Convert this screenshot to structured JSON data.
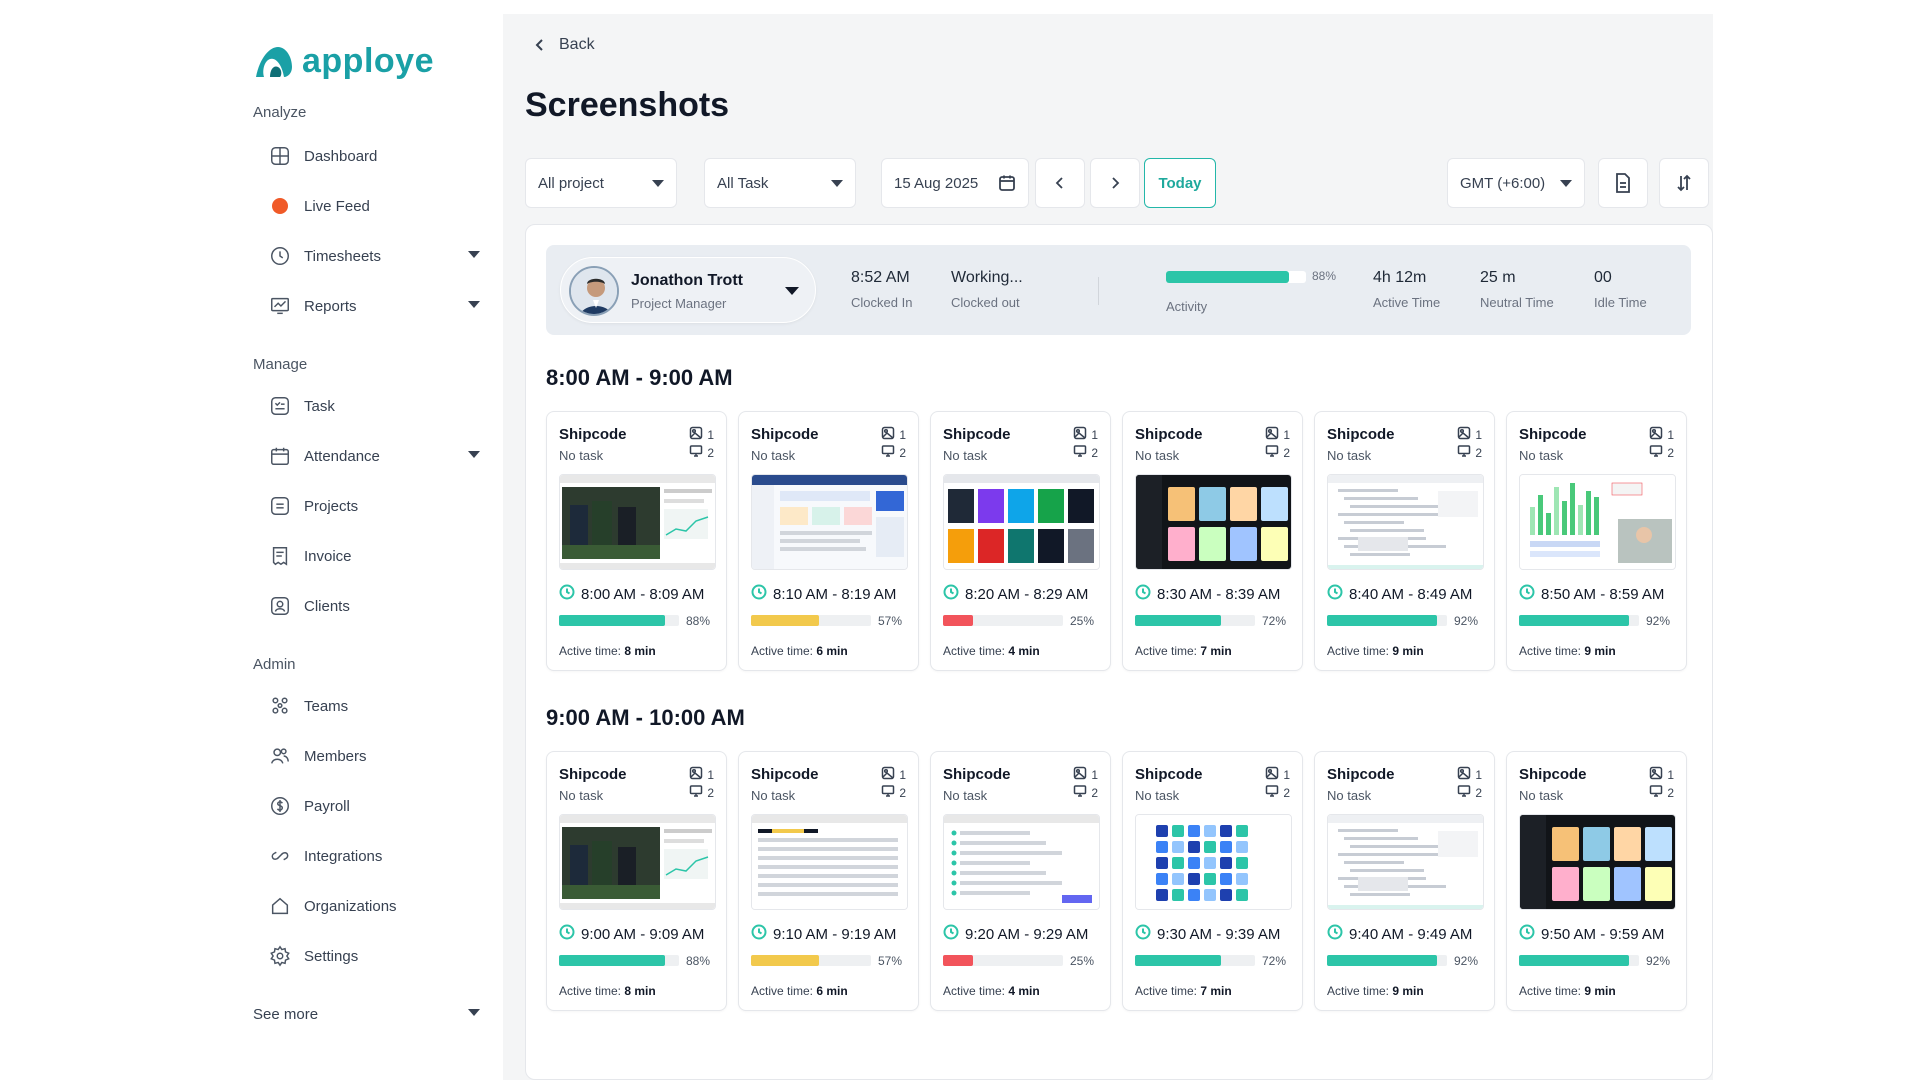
{
  "brand": {
    "name": "apploye",
    "color": "#1aa0a6"
  },
  "sidebar": {
    "sections": {
      "analyze": "Analyze",
      "manage": "Manage",
      "admin": "Admin"
    },
    "items": [
      {
        "label": "Dashboard",
        "icon": "dashboard-icon"
      },
      {
        "label": "Live Feed",
        "icon": "live-dot-icon"
      },
      {
        "label": "Timesheets",
        "icon": "clock-icon"
      },
      {
        "label": "Reports",
        "icon": "chart-icon"
      },
      {
        "label": "Task",
        "icon": "task-icon"
      },
      {
        "label": "Attendance",
        "icon": "calendar-icon"
      },
      {
        "label": "Projects",
        "icon": "projects-icon"
      },
      {
        "label": "Invoice",
        "icon": "invoice-icon"
      },
      {
        "label": "Clients",
        "icon": "clients-icon"
      },
      {
        "label": "Teams",
        "icon": "teams-icon"
      },
      {
        "label": "Members",
        "icon": "members-icon"
      },
      {
        "label": "Payroll",
        "icon": "payroll-icon"
      },
      {
        "label": "Integrations",
        "icon": "link-icon"
      },
      {
        "label": "Organizations",
        "icon": "home-icon"
      },
      {
        "label": "Settings",
        "icon": "gear-icon"
      }
    ],
    "see_more": "See more"
  },
  "header": {
    "back": "Back",
    "title": "Screenshots"
  },
  "filters": {
    "project": "All project",
    "task": "All Task",
    "date": "15 Aug 2025",
    "today": "Today",
    "timezone": "GMT (+6:00)"
  },
  "user": {
    "name": "Jonathon Trott",
    "role": "Project Manager",
    "clock_in": "8:52 AM",
    "clock_in_label": "Clocked In",
    "clock_out": "Working...",
    "clock_out_label": "Clocked out",
    "activity_pct": 88,
    "activity_text": "88%",
    "activity_label": "Activity",
    "active_time": "4h 12m",
    "active_time_label": "Active Time",
    "neutral_time": "25 m",
    "neutral_time_label": "Neutral Time",
    "idle_time": "00",
    "idle_time_label": "Idle Time"
  },
  "colors": {
    "accent": "#2cc5a8",
    "yellow": "#f2c94c",
    "red": "#f2545b"
  },
  "card_labels": {
    "active_prefix": "Active time: "
  },
  "hours": [
    {
      "title": "8:00 AM - 9:00 AM",
      "cards": [
        {
          "project": "Shipcode",
          "task": "No task",
          "count1": "1",
          "count2": "2",
          "time": "8:00 AM - 8:09 AM",
          "pct": 88,
          "pct_text": "88%",
          "active": "8 min",
          "color": "#2cc5a8",
          "thumb": "video"
        },
        {
          "project": "Shipcode",
          "task": "No task",
          "count1": "1",
          "count2": "2",
          "time": "8:10 AM - 8:19 AM",
          "pct": 57,
          "pct_text": "57%",
          "active": "6 min",
          "color": "#f2c94c",
          "thumb": "dashboard"
        },
        {
          "project": "Shipcode",
          "task": "No task",
          "count1": "1",
          "count2": "2",
          "time": "8:20 AM - 8:29 AM",
          "pct": 25,
          "pct_text": "25%",
          "active": "4 min",
          "color": "#f2545b",
          "thumb": "gallery"
        },
        {
          "project": "Shipcode",
          "task": "No task",
          "count1": "1",
          "count2": "2",
          "time": "8:30 AM - 8:39 AM",
          "pct": 72,
          "pct_text": "72%",
          "active": "7 min",
          "color": "#2cc5a8",
          "thumb": "dark"
        },
        {
          "project": "Shipcode",
          "task": "No task",
          "count1": "1",
          "count2": "2",
          "time": "8:40 AM - 8:49 AM",
          "pct": 92,
          "pct_text": "92%",
          "active": "9 min",
          "color": "#2cc5a8",
          "thumb": "doc"
        },
        {
          "project": "Shipcode",
          "task": "No task",
          "count1": "1",
          "count2": "2",
          "time": "8:50 AM - 8:59 AM",
          "pct": 92,
          "pct_text": "92%",
          "active": "9 min",
          "color": "#2cc5a8",
          "thumb": "bars"
        }
      ]
    },
    {
      "title": "9:00 AM - 10:00 AM",
      "cards": [
        {
          "project": "Shipcode",
          "task": "No task",
          "count1": "1",
          "count2": "2",
          "time": "9:00 AM - 9:09 AM",
          "pct": 88,
          "pct_text": "88%",
          "active": "8 min",
          "color": "#2cc5a8",
          "thumb": "video"
        },
        {
          "project": "Shipcode",
          "task": "No task",
          "count1": "1",
          "count2": "2",
          "time": "9:10 AM - 9:19 AM",
          "pct": 57,
          "pct_text": "57%",
          "active": "6 min",
          "color": "#f2c94c",
          "thumb": "table"
        },
        {
          "project": "Shipcode",
          "task": "No task",
          "count1": "1",
          "count2": "2",
          "time": "9:20 AM - 9:29 AM",
          "pct": 25,
          "pct_text": "25%",
          "active": "4 min",
          "color": "#f2545b",
          "thumb": "list"
        },
        {
          "project": "Shipcode",
          "task": "No task",
          "count1": "1",
          "count2": "2",
          "time": "9:30 AM - 9:39 AM",
          "pct": 72,
          "pct_text": "72%",
          "active": "7 min",
          "color": "#2cc5a8",
          "thumb": "grid"
        },
        {
          "project": "Shipcode",
          "task": "No task",
          "count1": "1",
          "count2": "2",
          "time": "9:40 AM - 9:49 AM",
          "pct": 92,
          "pct_text": "92%",
          "active": "9 min",
          "color": "#2cc5a8",
          "thumb": "doc"
        },
        {
          "project": "Shipcode",
          "task": "No task",
          "count1": "1",
          "count2": "2",
          "time": "9:50 AM - 9:59 AM",
          "pct": 92,
          "pct_text": "92%",
          "active": "9 min",
          "color": "#2cc5a8",
          "thumb": "dark"
        }
      ]
    }
  ]
}
